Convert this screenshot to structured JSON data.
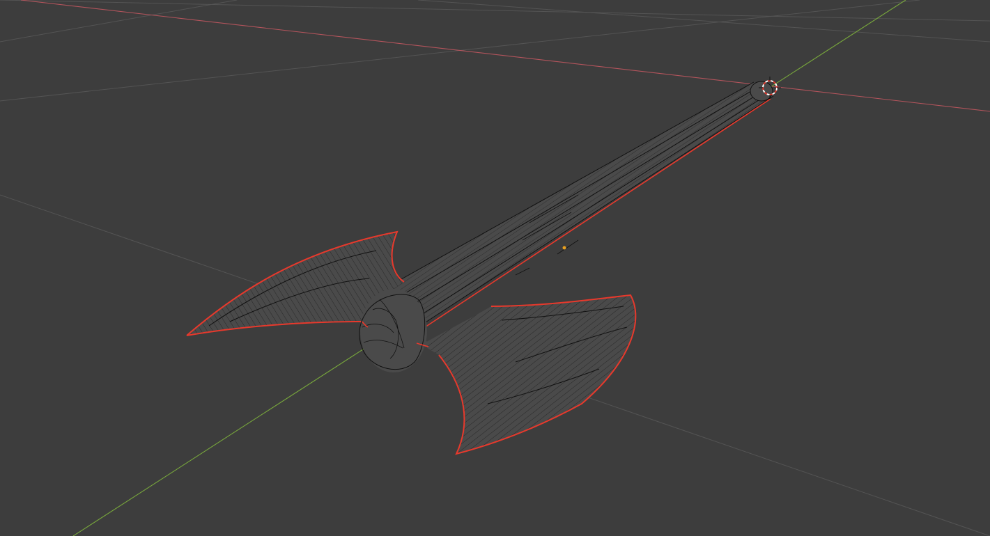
{
  "viewport": {
    "background": "#3d3d3d",
    "grid_color": "#545454",
    "x_axis_color": "#b4545c",
    "y_axis_color": "#78a73c",
    "mesh_wire_color": "#111111",
    "mesh_fill_color": "#4a4a4a",
    "selected_outline_color": "#e8392c",
    "origin_color": "#e8a020"
  },
  "scene": {
    "object": "axe",
    "shading_mode": "wireframe",
    "selected": true
  },
  "icons": {
    "origin": "origin-marker-icon",
    "cursor": "3d-cursor-icon"
  }
}
